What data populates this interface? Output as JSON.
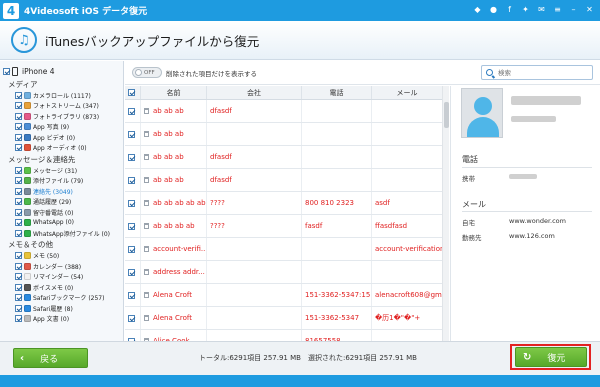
{
  "app": {
    "title": "4Videosoft iOS データ復元",
    "logo_char": "4"
  },
  "title_icons": [
    "diamond-icon",
    "user-icon",
    "facebook-icon",
    "twitter-icon",
    "feedback-icon",
    "menu-icon",
    "minimize-icon",
    "close-icon"
  ],
  "header": {
    "title": "iTunesバックアップファイルから復元"
  },
  "sidebar": {
    "device": "iPhone 4",
    "categories": [
      {
        "label": "メディア",
        "items": [
          {
            "label": "カメラロール (1117)",
            "color": "#6fb0e0"
          },
          {
            "label": "フォトストリーム (347)",
            "color": "#e8a23a"
          },
          {
            "label": "フォトライブラリ (873)",
            "color": "#e65b8a"
          },
          {
            "label": "App 写真 (9)",
            "color": "#4c8fd6"
          },
          {
            "label": "App ビデオ (0)",
            "color": "#3b7bc2"
          },
          {
            "label": "App オーディオ (0)",
            "color": "#e0533a"
          }
        ]
      },
      {
        "label": "メッセージ＆連絡先",
        "items": [
          {
            "label": "メッセージ (31)",
            "color": "#5cc24a"
          },
          {
            "label": "添付ファイル (79)",
            "color": "#55b24a"
          },
          {
            "label": "連絡先 (3049)",
            "color": "#7a8a9a",
            "selected": true
          },
          {
            "label": "通話履歴 (29)",
            "color": "#4cb84a"
          },
          {
            "label": "留守番電話 (0)",
            "color": "#8a9aaa"
          },
          {
            "label": "WhatsApp (0)",
            "color": "#2fb14a"
          },
          {
            "label": "WhatsApp添付ファイル (0)",
            "color": "#2fb14a"
          }
        ]
      },
      {
        "label": "メモ＆その他",
        "items": [
          {
            "label": "メモ (50)",
            "color": "#e8c33a"
          },
          {
            "label": "カレンダー (388)",
            "color": "#e05a4a"
          },
          {
            "label": "リマインダー (54)",
            "color": "#f0f0f0"
          },
          {
            "label": "ボイスメモ (0)",
            "color": "#555555"
          },
          {
            "label": "Safariブックマーク (257)",
            "color": "#2a8ae0"
          },
          {
            "label": "Safari履歴 (8)",
            "color": "#2a8ae0"
          },
          {
            "label": "App 文書 (0)",
            "color": "#bbbbbb"
          }
        ]
      }
    ]
  },
  "toolbar": {
    "toggle_state": "OFF",
    "toggle_label": "削除された項目だけを表示する",
    "search_placeholder": "検索"
  },
  "table": {
    "headers": [
      "名前",
      "会社",
      "電話",
      "メール"
    ],
    "rows": [
      {
        "name": "ab ab ab",
        "company": "dfasdf",
        "phone": "",
        "email": ""
      },
      {
        "name": "ab ab ab",
        "company": "",
        "phone": "",
        "email": ""
      },
      {
        "name": "ab ab ab",
        "company": "dfasdf",
        "phone": "",
        "email": ""
      },
      {
        "name": "ab ab ab",
        "company": "dfasdf",
        "phone": "",
        "email": ""
      },
      {
        "name": "ab ab ab ab ab",
        "company": "????",
        "phone": "800 810 2323",
        "email": "asdf"
      },
      {
        "name": "ab ab ab ab",
        "company": "????",
        "phone": "fasdf",
        "email": "ffasdfasd"
      },
      {
        "name": "account-verifi...",
        "company": "",
        "phone": "",
        "email": "account-verification..."
      },
      {
        "name": "address addr...",
        "company": "",
        "phone": "",
        "email": ""
      },
      {
        "name": "Alena Croft",
        "company": "",
        "phone": "151-3362-5347:15...",
        "email": "alenacroft608@gm..."
      },
      {
        "name": "Alena Croft",
        "company": "",
        "phone": "151-3362-5347",
        "email": "�历1�\"�\"+"
      },
      {
        "name": "Alice Cook",
        "company": "",
        "phone": "81657558",
        "email": ""
      },
      {
        "name": "alim f12 m l s1",
        "company": "c",
        "phone": "",
        "email": ""
      }
    ]
  },
  "detail": {
    "phone_section": "電話",
    "phone_key": "携帯",
    "mail_section": "メール",
    "home_key": "自宅",
    "home_val": "www.wonder.com",
    "work_key": "勤務先",
    "work_val": "www.126.com"
  },
  "footer": {
    "back_label": "戻る",
    "stats": "トータル:6291項目 257.91 MB　選択された:6291項目 257.91 MB",
    "restore_label": "復元"
  }
}
